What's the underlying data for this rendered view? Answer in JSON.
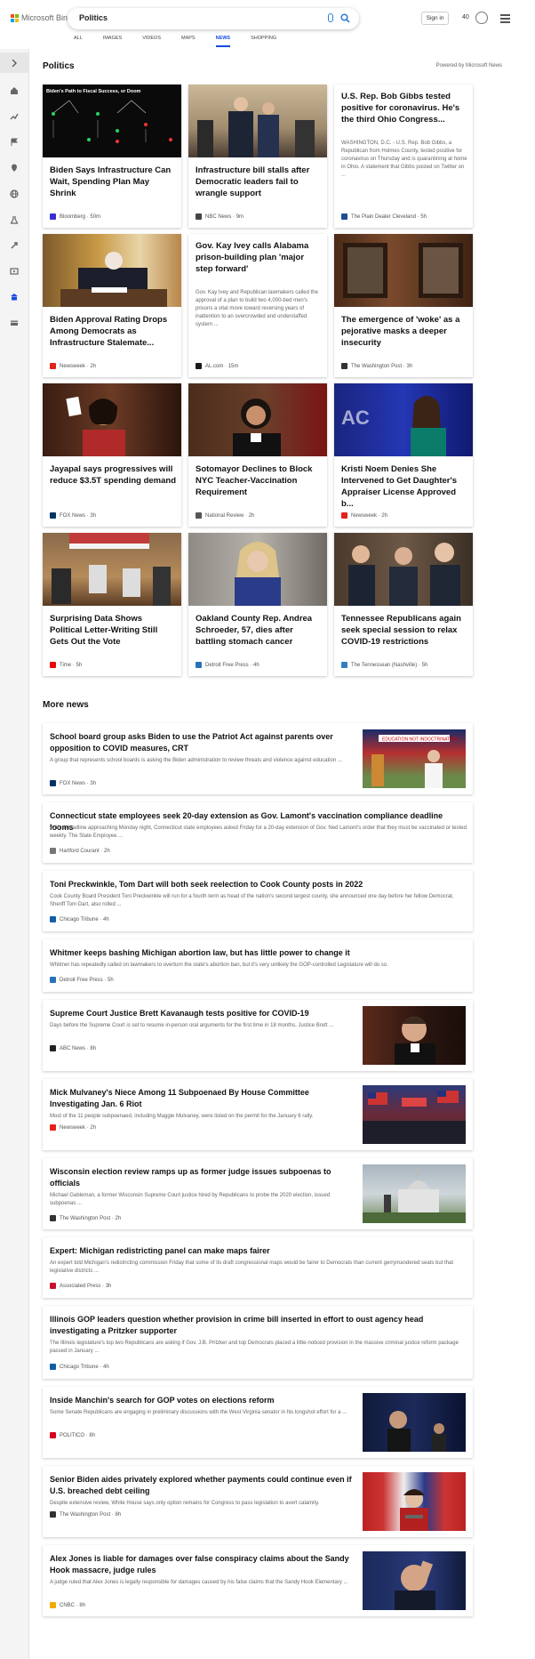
{
  "header": {
    "logo_text": "Microsoft Bing",
    "search_value": "Politics",
    "signin_label": "Sign in",
    "rewards_count": "40"
  },
  "tabs": [
    "ALL",
    "IMAGES",
    "VIDEOS",
    "MAPS",
    "NEWS",
    "SHOPPING"
  ],
  "section": {
    "title": "Politics",
    "powered": "Powered by Microsoft News"
  },
  "cards": [
    {
      "title": "Biden Says Infrastructure Can Wait, Spending Plan May Shrink",
      "source": "Bloomberg",
      "time": "50m",
      "icon": "#3b2ed0"
    },
    {
      "title": "Infrastructure bill stalls after Democratic leaders fail to wrangle support",
      "source": "NBC News",
      "time": "9m",
      "icon": "#444"
    },
    {
      "title": "U.S. Rep. Bob Gibbs tested positive for coronavirus. He's the third Ohio Congress...",
      "desc": "WASHINGTON, D.C. - U.S. Rep. Bob Gibbs, a Republican from Holmes County, tested positive for coronavirus on Thursday and is quarantining at home in Ohio. A statement that Gibbs posted on Twitter on ...",
      "source": "The Plain Dealer Cleveland",
      "time": "5h",
      "icon": "#1d4f91"
    },
    {
      "title": "Biden Approval Rating Drops Among Democrats as Infrastructure Stalemate...",
      "source": "Newsweek",
      "time": "2h",
      "icon": "#e2231a"
    },
    {
      "title": "Gov. Kay Ivey calls Alabama prison-building plan 'major step forward'",
      "desc": "Gov. Kay Ivey and Republican lawmakers called the approval of a plan to build two 4,000-bed men's prisons a vital move toward reversing years of inattention to an overcrowded and understaffed system ...",
      "source": "AL.com",
      "time": "15m",
      "icon": "#1a1a1a"
    },
    {
      "title": "The emergence of 'woke' as a pejorative masks a deeper insecurity",
      "source": "The Washington Post",
      "time": "3h",
      "icon": "#333"
    },
    {
      "title": "Jayapal says progressives will reduce $3.5T spending demand",
      "source": "FOX News",
      "time": "3h",
      "icon": "#003366"
    },
    {
      "title": "Sotomayor Declines to Block NYC Teacher-Vaccination Requirement",
      "source": "National Review",
      "time": "2h",
      "icon": "#555"
    },
    {
      "title": "Kristi Noem Denies She Intervened to Get Daughter's Appraiser License Approved b...",
      "source": "Newsweek",
      "time": "2h",
      "icon": "#e2231a"
    },
    {
      "title": "Surprising Data Shows Political Letter-Writing Still Gets Out the Vote",
      "source": "Time",
      "time": "5h",
      "icon": "#e90606"
    },
    {
      "title": "Oakland County Rep. Andrea Schroeder, 57, dies after battling stomach cancer",
      "source": "Detroit Free Press",
      "time": "4h",
      "icon": "#2a72b8"
    },
    {
      "title": "Tennessee Republicans again seek special session to relax COVID-19 restrictions",
      "source": "The Tennessean (Nashville)",
      "time": "5h",
      "icon": "#2f7fc1"
    }
  ],
  "more_news": {
    "title": "More news",
    "items": [
      {
        "title": "School board group asks Biden to use the Patriot Act against parents over opposition to COVID measures, CRT",
        "snippet": "A group that represents school boards is asking the Biden administration to review threats and violence against education ...",
        "source": "FOX News",
        "time": "3h",
        "icon": "#003366"
      },
      {
        "title": "Connecticut state employees seek 20-day extension as Gov. Lamont's vaccination compliance deadline looms",
        "snippet": "With a deadline approaching Monday night, Connecticut state employees asked Friday for a 20-day extension of Gov. Ned Lamont's order that they must be vaccinated or tested weekly. The State Employee ...",
        "source": "Hartford Courant",
        "time": "2h",
        "icon": "#777"
      },
      {
        "title": "Toni Preckwinkle, Tom Dart will both seek reelection to Cook County posts in 2022",
        "snippet": "Cook County Board President Toni Preckwinkle will run for a fourth term as head of the nation's second largest county, she announced one day before her fellow Democrat, Sheriff Tom Dart, also rolled ...",
        "source": "Chicago Tribune",
        "time": "4h",
        "icon": "#0e5fa8"
      },
      {
        "title": "Whitmer keeps bashing Michigan abortion law, but has little power to change it",
        "snippet": "Whitmer has repeatedly called on lawmakers to overturn the state's abortion ban, but it's very unlikely the GOP-controlled Legislature will do so.",
        "source": "Detroit Free Press",
        "time": "5h",
        "icon": "#2a72b8"
      },
      {
        "title": "Supreme Court Justice Brett Kavanaugh tests positive for COVID-19",
        "snippet": "Days before the Supreme Court is set to resume in-person oral arguments for the first time in 18 months, Justice Brett ...",
        "source": "ABC News",
        "time": "8h",
        "icon": "#222"
      },
      {
        "title": "Mick Mulvaney's Niece Among 11 Subpoenaed By House Committee Investigating Jan. 6 Riot",
        "snippet": "Most of the 11 people subpoenaed, including Maggie Mulvaney, were listed on the permit for the January 6 rally.",
        "source": "Newsweek",
        "time": "2h",
        "icon": "#e2231a"
      },
      {
        "title": "Wisconsin election review ramps up as former judge issues subpoenas to officials",
        "snippet": "Michael Gableman, a former Wisconsin Supreme Court justice hired by Republicans to probe the 2020 election, issued subpoenas ...",
        "source": "The Washington Post",
        "time": "2h",
        "icon": "#333"
      },
      {
        "title": "Expert: Michigan redistricting panel can make maps fairer",
        "snippet": "An expert told Michigan's redistricting commission Friday that some of its draft congressional maps would be fairer to Democrats than current gerrymandered seats but that legislative districts ...",
        "source": "Associated Press",
        "time": "3h",
        "icon": "#c8102e"
      },
      {
        "title": "Illinois GOP leaders question whether provision in crime bill inserted in effort to oust agency head investigating a Pritzker supporter",
        "snippet": "The Illinois legislature's top two Republicans are asking if Gov. J.B. Pritzker and top Democrats placed a little-noticed provision in the massive criminal justice reform package passed in January ...",
        "source": "Chicago Tribune",
        "time": "4h",
        "icon": "#0e5fa8"
      },
      {
        "title": "Inside Manchin's search for GOP votes on elections reform",
        "snippet": "Some Senate Republicans are engaging in preliminary discussions with the West Virginia senator in his longshot effort for a ...",
        "source": "POLITICO",
        "time": "8h",
        "icon": "#d6001c"
      },
      {
        "title": "Senior Biden aides privately explored whether payments could continue even if U.S. breached debt ceiling",
        "snippet": "Despite extensive review, White House says only option remains for Congress to pass legislation to avert calamity.",
        "source": "The Washington Post",
        "time": "8h",
        "icon": "#333"
      },
      {
        "title": "Alex Jones is liable for damages over false conspiracy claims about the Sandy Hook massacre, judge rules",
        "snippet": "A judge ruled that Alex Jones is legally responsible for damages caused by his false claims that the Sandy Hook Elementary ...",
        "source": "CNBC",
        "time": "8h",
        "icon": "#f0ab00"
      }
    ]
  },
  "sidebar_icons": [
    "home-icon",
    "trending-icon",
    "flag-icon",
    "location-icon",
    "globe-icon",
    "science-icon",
    "rocket-icon",
    "video-icon",
    "government-icon",
    "card-icon"
  ],
  "colors": {
    "accent": "#174ae4",
    "mic": "#2b7cd3"
  }
}
